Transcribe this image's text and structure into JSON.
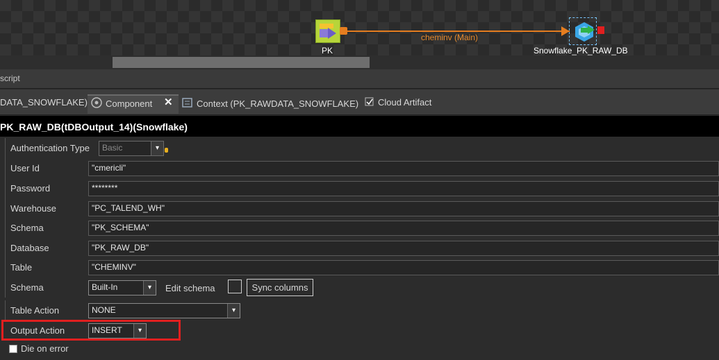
{
  "canvas": {
    "source_node_label": "PK",
    "target_node_label": "Snowflake_PK_RAW_DB",
    "link_label": "cheminv (Main)"
  },
  "script_bar": {
    "label": "script"
  },
  "tabs": [
    {
      "label": "DATA_SNOWFLAKE)",
      "icon": "none"
    },
    {
      "label": "Component",
      "icon": "component-icon",
      "active": true
    },
    {
      "label": "Context (PK_RAWDATA_SNOWFLAKE)",
      "icon": "context-icon"
    },
    {
      "label": "Cloud Artifact",
      "icon": "cloud-artifact-icon"
    }
  ],
  "component_title": "PK_RAW_DB(tDBOutput_14)(Snowflake)",
  "properties": {
    "authentication_type": {
      "label": "Authentication Type",
      "value": "Basic"
    },
    "user_id": {
      "label": "User Id",
      "value": "\"cmericli\""
    },
    "password": {
      "label": "Password",
      "value": "********"
    },
    "warehouse": {
      "label": "Warehouse",
      "value": "\"PC_TALEND_WH\""
    },
    "schema": {
      "label": "Schema",
      "value": "\"PK_SCHEMA\""
    },
    "database": {
      "label": "Database",
      "value": "\"PK_RAW_DB\""
    },
    "table": {
      "label": "Table",
      "value": "\"CHEMINV\""
    },
    "schema_type": {
      "label": "Schema",
      "value": "Built-In",
      "edit_schema_label": "Edit schema",
      "sync_label": "Sync columns"
    },
    "table_action": {
      "label": "Table Action",
      "value": "NONE"
    },
    "output_action": {
      "label": "Output Action",
      "value": "INSERT"
    },
    "die_on_error": {
      "label": "Die on error",
      "checked": false
    }
  },
  "colors": {
    "link": "#e57d1f",
    "highlight": "#e11f1f",
    "pk_node": "#b7d53a"
  }
}
